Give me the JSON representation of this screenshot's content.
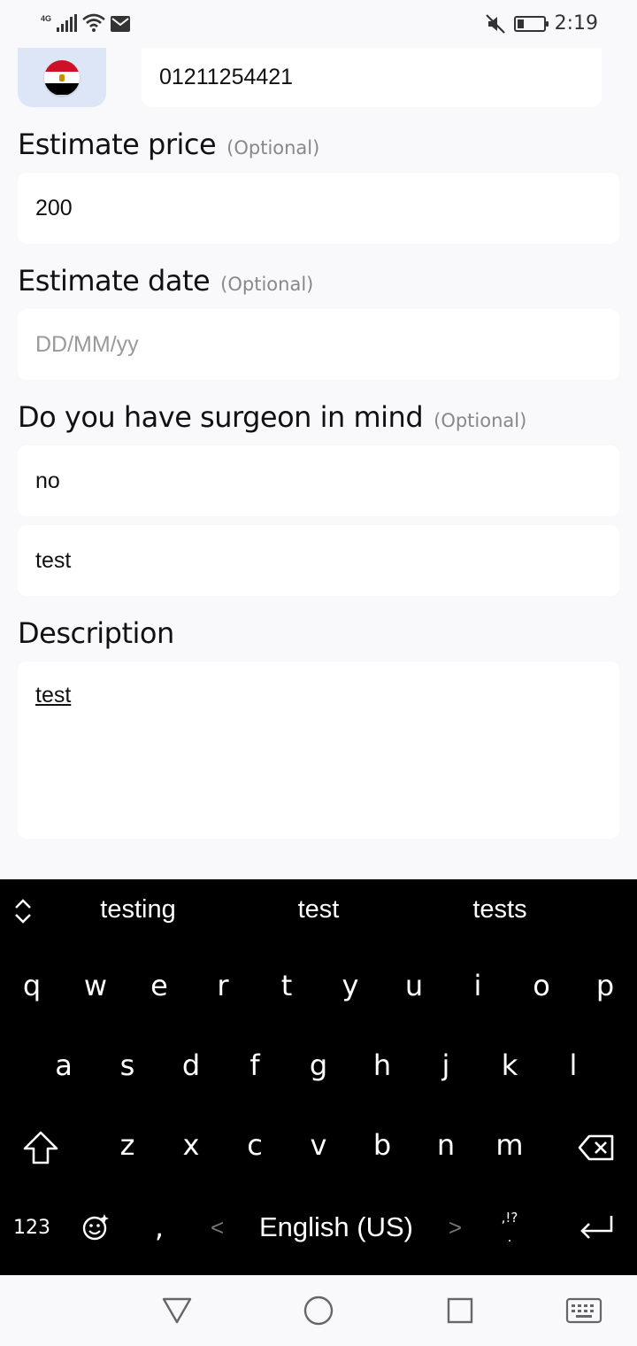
{
  "status_bar": {
    "network": "4G",
    "time": "2:19",
    "battery_level": 0.25
  },
  "form": {
    "phone_value": "01211254421",
    "estimate_price": {
      "label": "Estimate price",
      "optional": "(Optional)",
      "value": "200"
    },
    "estimate_date": {
      "label": "Estimate date",
      "optional": "(Optional)",
      "placeholder": "DD/MM/yy"
    },
    "surgeon": {
      "label": "Do you have surgeon in mind",
      "optional": "(Optional)",
      "choice": "no",
      "name": "test"
    },
    "description": {
      "label": "Description",
      "value": "test"
    }
  },
  "keyboard": {
    "suggestions": [
      "testing",
      "test",
      "tests"
    ],
    "row1": [
      "q",
      "w",
      "e",
      "r",
      "t",
      "y",
      "u",
      "i",
      "o",
      "p"
    ],
    "row2": [
      "a",
      "s",
      "d",
      "f",
      "g",
      "h",
      "j",
      "k",
      "l"
    ],
    "row3": [
      "z",
      "x",
      "c",
      "v",
      "b",
      "n",
      "m"
    ],
    "numbers_key": "123",
    "comma_key": ",",
    "punct_key_top": ",!?",
    "punct_key_bottom": ".",
    "language": "English (US)",
    "arrow_left": "<",
    "arrow_right": ">"
  }
}
